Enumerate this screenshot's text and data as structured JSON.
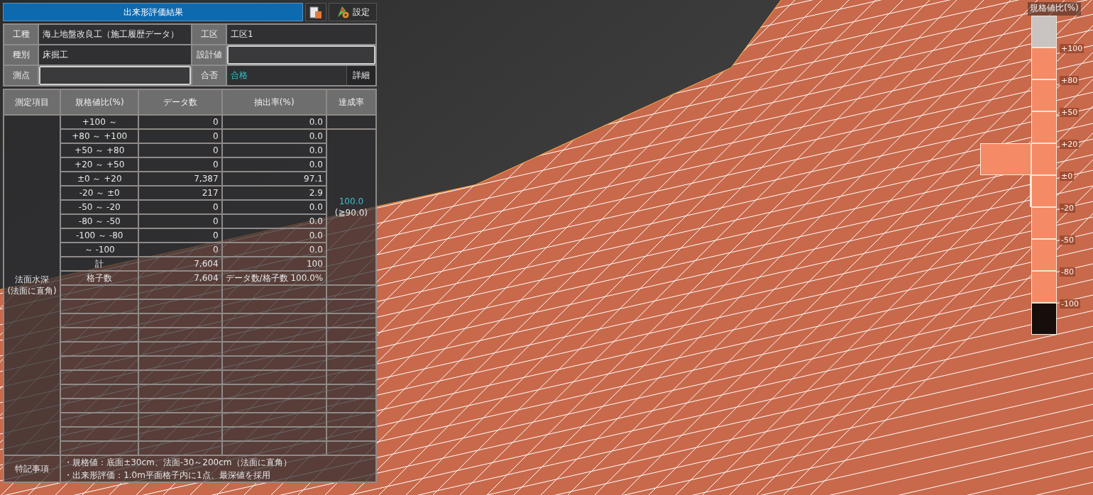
{
  "panel": {
    "title": "出来形評価結果",
    "settings_label": "設定",
    "info": [
      {
        "label": "工種",
        "value": "海上地盤改良工（施工履歴データ）",
        "kind": "text"
      },
      {
        "label": "工区",
        "value": "工区1",
        "kind": "text"
      },
      {
        "label": "種別",
        "value": "床掘工",
        "kind": "text"
      },
      {
        "label": "設計値",
        "kind": "input"
      },
      {
        "label": "測点",
        "kind": "input"
      },
      {
        "label": "合否",
        "value": "合格",
        "kind": "result",
        "detail_label": "詳細"
      }
    ]
  },
  "table": {
    "columns": [
      "測定項目",
      "規格値比(%)",
      "データ数",
      "抽出率(%)",
      "達成率"
    ],
    "item": [
      "法面水深",
      "(法面に直角)"
    ],
    "rows": [
      {
        "range": "+100 ～",
        "count": "0",
        "rate": "0.0"
      },
      {
        "range": "+80 ～ +100",
        "count": "0",
        "rate": "0.0"
      },
      {
        "range": "+50 ～ +80",
        "count": "0",
        "rate": "0.0"
      },
      {
        "range": "+20 ～ +50",
        "count": "0",
        "rate": "0.0"
      },
      {
        "range": "±0 ～ +20",
        "count": "7,387",
        "rate": "97.1"
      },
      {
        "range": "-20 ～ ±0",
        "count": "217",
        "rate": "2.9"
      },
      {
        "range": "-50 ～ -20",
        "count": "0",
        "rate": "0.0"
      },
      {
        "range": "-80 ～ -50",
        "count": "0",
        "rate": "0.0"
      },
      {
        "range": "-100 ～ -80",
        "count": "0",
        "rate": "0.0"
      },
      {
        "range": "～ -100",
        "count": "0",
        "rate": "0.0"
      },
      {
        "range": "計",
        "count": "7,604",
        "rate": "100"
      },
      {
        "range": "格子数",
        "count": "7,604",
        "rate": "データ数/格子数 100.0%"
      }
    ],
    "achievement": "100.0",
    "threshold": "(≧90.0)",
    "notes_label": "特記事項",
    "notes": [
      "・規格値：底面±30cm、法面-30～200cm（法面に直角）",
      "・出来形評価：1.0m平面格子内に1点、最深値を採用"
    ]
  },
  "legend": {
    "title": "規格値比(%)",
    "segments": [
      {
        "color": "#c9c3c1",
        "tick": "+100"
      },
      {
        "color": "#f48a66",
        "tick": "+80"
      },
      {
        "color": "#f48a66",
        "tick": "+50"
      },
      {
        "color": "#f48a66",
        "tick": "+20"
      },
      {
        "color": "#f48a66",
        "level": 0.971,
        "tick": "±0"
      },
      {
        "color": "#f48a66",
        "level": 0.029,
        "tick": "-20"
      },
      {
        "color": "#f48a66",
        "tick": "-50"
      },
      {
        "color": "#f48a66",
        "tick": "-80"
      },
      {
        "color": "#f48a66",
        "tick": "-100"
      },
      {
        "color": "#150e0b"
      }
    ]
  }
}
